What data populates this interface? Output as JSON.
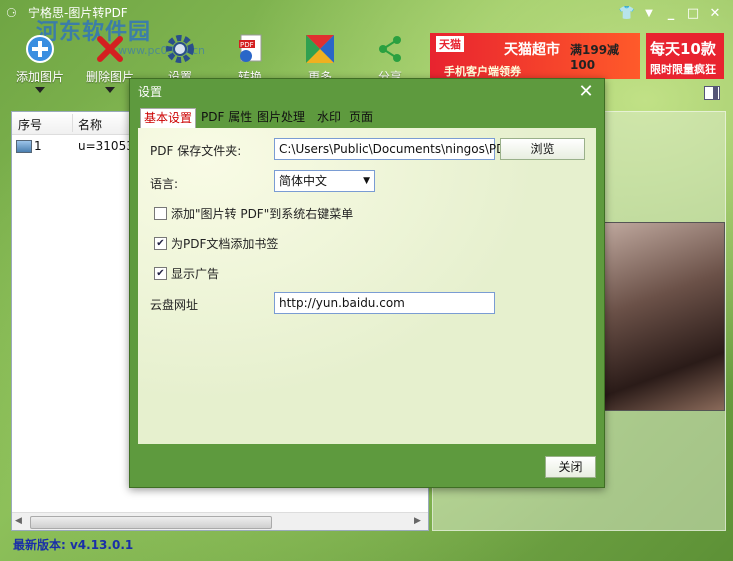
{
  "window": {
    "title": "宁格思-图片转PDF",
    "watermark": "河东软件园",
    "watermark_sub": "www.pc0359.cn"
  },
  "toolbar": {
    "add_label": "添加图片",
    "delete_label": "删除图片",
    "settings_label": "设置",
    "convert_label": "转换",
    "more_label": "更多",
    "share_label": "分享"
  },
  "ads": {
    "tmall_logo": "天猫",
    "tmall_market": "天猫超市",
    "promo": "满199减100",
    "promo_sub": "手机客户端领券",
    "daily": "每天10款",
    "daily_sub": "限时限量疯狂"
  },
  "list": {
    "col_index": "序号",
    "col_name": "名称",
    "rows": [
      {
        "index": "1",
        "name": "u=31053"
      }
    ]
  },
  "dialog": {
    "title": "设置",
    "tabs": [
      "基本设置",
      "PDF 属性",
      "图片处理",
      "水印",
      "页面"
    ],
    "save_folder_label": "PDF 保存文件夹:",
    "save_folder_value": "C:\\Users\\Public\\Documents\\ningos\\PDF",
    "browse_label": "浏览",
    "language_label": "语言:",
    "language_value": "简体中文",
    "context_menu_label": "添加\"图片转 PDF\"到系统右键菜单",
    "bookmark_label": "为PDF文档添加书签",
    "show_ads_label": "显示广告",
    "cloud_label": "云盘网址",
    "cloud_value": "http://yun.baidu.com",
    "close_label": "关闭"
  },
  "status": {
    "version": "最新版本: v4.13.0.1"
  },
  "colors": {
    "accent_green": "#5e9a3e",
    "version_blue": "#1a2fa8",
    "active_tab_red": "#cc0000"
  }
}
